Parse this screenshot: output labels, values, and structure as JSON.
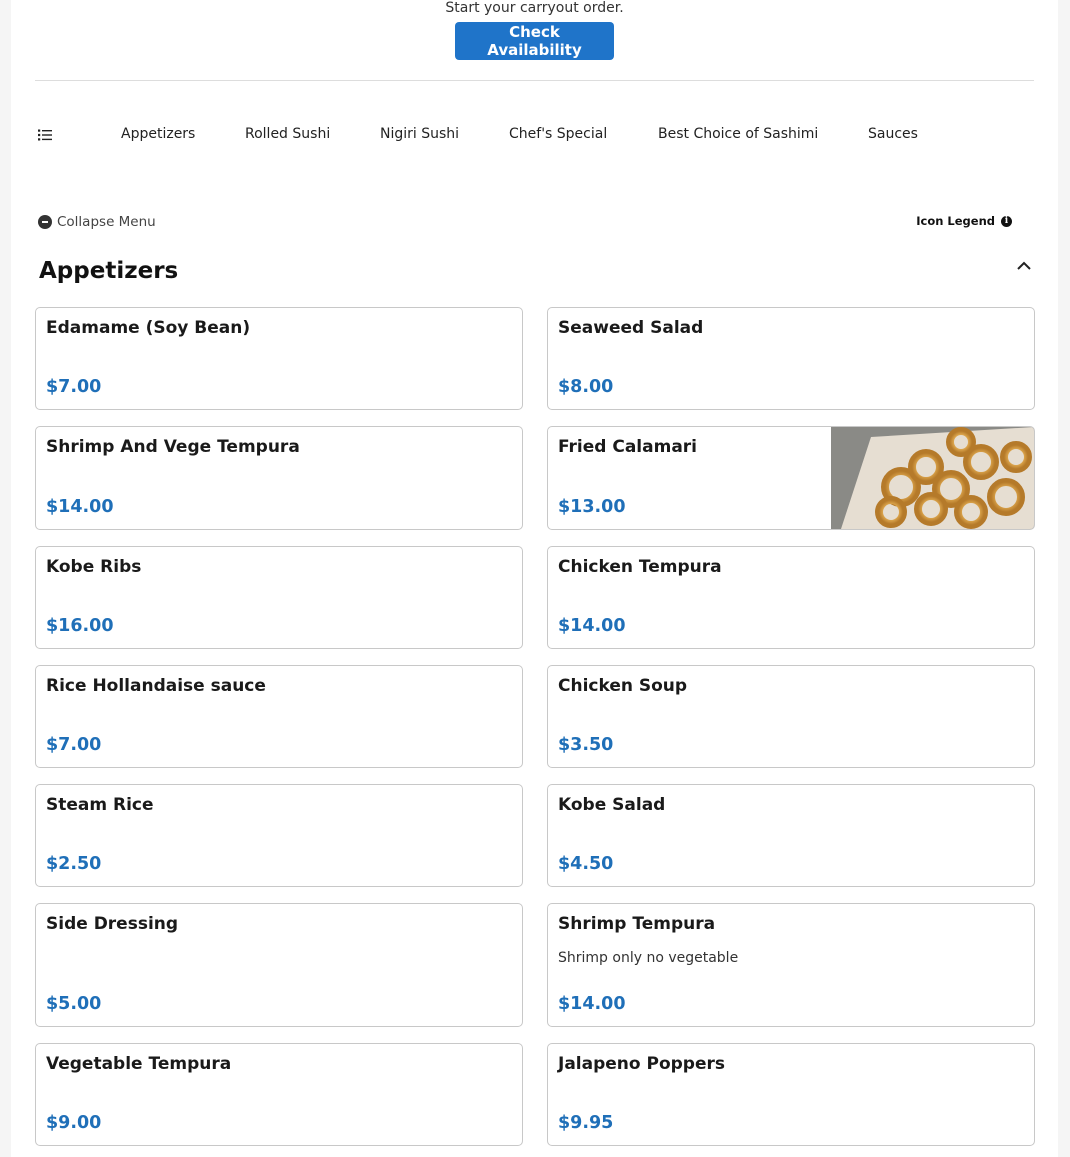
{
  "header": {
    "carryout_text": "Start your carryout order.",
    "check_button": "Check Availability"
  },
  "categories": {
    "menu_icon": "list-icon",
    "tabs": [
      "Appetizers",
      "Rolled Sushi",
      "Nigiri Sushi",
      "Chef's Special",
      "Best Choice of Sashimi",
      "Sauces"
    ]
  },
  "controls": {
    "collapse_label": "Collapse Menu",
    "legend_label": "Icon Legend",
    "legend_icon": "info-icon",
    "collapse_icon": "minus-circle-icon"
  },
  "section": {
    "title": "Appetizers",
    "toggle_icon": "chevron-up-icon"
  },
  "items": [
    {
      "name": "Edamame (Soy Bean)",
      "price": "$7.00",
      "description": ""
    },
    {
      "name": "Seaweed Salad",
      "price": "$8.00",
      "description": ""
    },
    {
      "name": "Shrimp And Vege Tempura",
      "price": "$14.00",
      "description": ""
    },
    {
      "name": "Fried Calamari",
      "price": "$13.00",
      "description": "",
      "has_photo": true
    },
    {
      "name": "Kobe Ribs",
      "price": "$16.00",
      "description": ""
    },
    {
      "name": "Chicken Tempura",
      "price": "$14.00",
      "description": ""
    },
    {
      "name": "Rice Hollandaise sauce",
      "price": "$7.00",
      "description": ""
    },
    {
      "name": "Chicken Soup",
      "price": "$3.50",
      "description": ""
    },
    {
      "name": "Steam Rice",
      "price": "$2.50",
      "description": ""
    },
    {
      "name": "Kobe Salad",
      "price": "$4.50",
      "description": ""
    },
    {
      "name": "Side Dressing",
      "price": "$5.00",
      "description": ""
    },
    {
      "name": "Shrimp Tempura",
      "price": "$14.00",
      "description": "Shrimp only no vegetable"
    },
    {
      "name": "Vegetable Tempura",
      "price": "$9.00",
      "description": ""
    },
    {
      "name": "Jalapeno Poppers",
      "price": "$9.95",
      "description": ""
    }
  ],
  "colors": {
    "accent": "#1f74c9",
    "price": "#1f6fb8"
  }
}
